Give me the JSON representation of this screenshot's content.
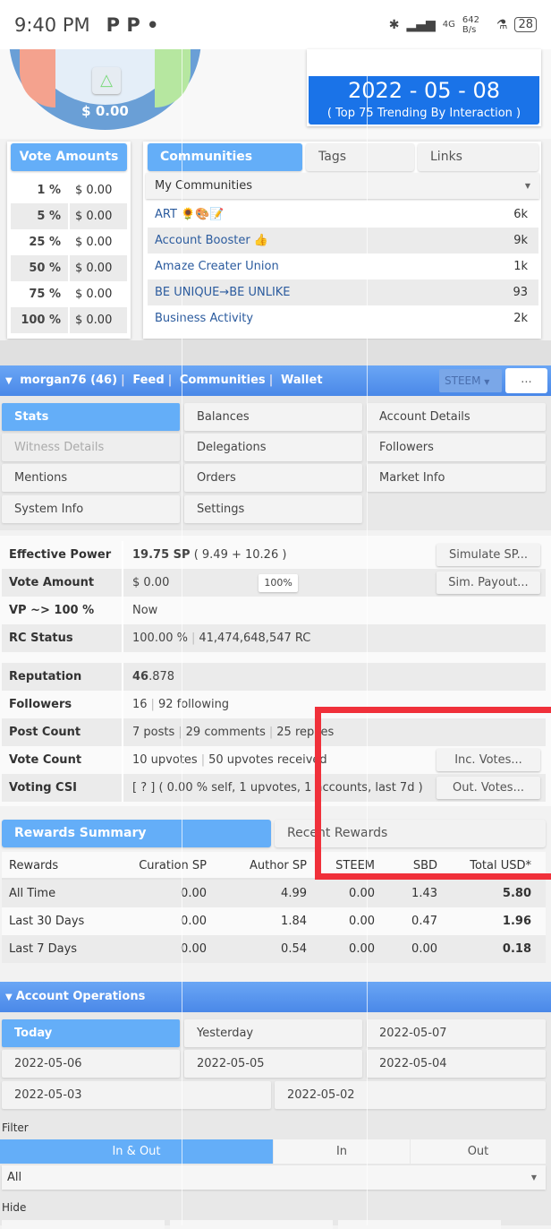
{
  "status_bar": {
    "time": "9:40 PM",
    "apps": "P  P  •",
    "net_speed": "642 B/s",
    "battery": "28",
    "signal": "4G"
  },
  "gauge": {
    "value": "$ 0.00",
    "button": "△"
  },
  "date_box": {
    "date": "2022 - 05 - 08",
    "subtitle": "( Top 75 Trending By Interaction )"
  },
  "vote_amounts": {
    "title": "Vote Amounts",
    "rows": [
      {
        "p": "1 %",
        "v": "$ 0.00"
      },
      {
        "p": "5 %",
        "v": "$ 0.00"
      },
      {
        "p": "25 %",
        "v": "$ 0.00"
      },
      {
        "p": "50 %",
        "v": "$ 0.00"
      },
      {
        "p": "75 %",
        "v": "$ 0.00"
      },
      {
        "p": "100 %",
        "v": "$ 0.00"
      }
    ]
  },
  "communities": {
    "tabs": [
      "Communities",
      "Tags",
      "Links"
    ],
    "dropdown": "My Communities",
    "rows": [
      {
        "n": "ART 🌻🎨📝",
        "c": "6k"
      },
      {
        "n": "Account Booster 👍",
        "c": "9k"
      },
      {
        "n": "Amaze Creater Union",
        "c": "1k"
      },
      {
        "n": "BE UNIQUE→BE UNLIKE",
        "c": "93"
      },
      {
        "n": "Business Activity",
        "c": "2k"
      }
    ]
  },
  "account_bar": {
    "user": "morgan76 (46)",
    "links": [
      "Feed",
      "Communities",
      "Wallet"
    ],
    "currency": "STEEM",
    "more": "..."
  },
  "nav": [
    "Stats",
    "Balances",
    "Account Details",
    "Witness Details",
    "Delegations",
    "Followers",
    "Mentions",
    "Orders",
    "Market Info",
    "System Info",
    "Settings"
  ],
  "stats": {
    "effective_power": {
      "label": "Effective Power",
      "main": "19.75 SP",
      "detail": "( 9.49 + 10.26 )",
      "button": "Simulate SP..."
    },
    "vote_amount": {
      "label": "Vote Amount",
      "value": "$ 0.00",
      "slider": "100%",
      "slider_value": 100,
      "button": "Sim. Payout..."
    },
    "vp": {
      "label": "VP ~> 100 %",
      "value": "Now"
    },
    "rc": {
      "label": "RC Status",
      "pct": "100.00 %",
      "value": "41,474,648,547 RC"
    },
    "reputation": {
      "label": "Reputation",
      "main": "46",
      "rest": ".878"
    },
    "followers": {
      "label": "Followers",
      "a": "16",
      "b": "92 following"
    },
    "post_count": {
      "label": "Post Count",
      "a": "7 posts",
      "b": "29 comments",
      "c": "25 replies"
    },
    "vote_count": {
      "label": "Vote Count",
      "a": "10 upvotes",
      "b": "50 upvotes received",
      "button": "Inc. Votes..."
    },
    "csi": {
      "label": "Voting CSI",
      "value": "[ ? ] ( 0.00 % self, 1 upvotes, 1 accounts, last 7d )",
      "button": "Out. Votes..."
    }
  },
  "rewards": {
    "tabs": [
      "Rewards Summary",
      "Recent Rewards"
    ],
    "headers": [
      "Rewards",
      "Curation SP",
      "Author SP",
      "STEEM",
      "SBD",
      "Total USD*"
    ],
    "rows": [
      [
        "All Time",
        "0.00",
        "4.99",
        "0.00",
        "1.43",
        "5.80"
      ],
      [
        "Last 30 Days",
        "0.00",
        "1.84",
        "0.00",
        "0.47",
        "1.96"
      ],
      [
        "Last 7 Days",
        "0.00",
        "0.54",
        "0.00",
        "0.00",
        "0.18"
      ]
    ]
  },
  "operations": {
    "title": "Account Operations",
    "dates": [
      "Today",
      "Yesterday",
      "2022-05-07",
      "2022-05-06",
      "2022-05-05",
      "2022-05-04",
      "2022-05-03",
      "2022-05-02"
    ],
    "filter_label": "Filter",
    "filters": [
      "In & Out",
      "In",
      "Out"
    ],
    "select": "All",
    "hide_label": "Hide"
  },
  "colors": {
    "accent": "#64aef8",
    "bar": "#4a88e8",
    "date_box": "#1a73e8",
    "annotation": "#f0303a"
  }
}
